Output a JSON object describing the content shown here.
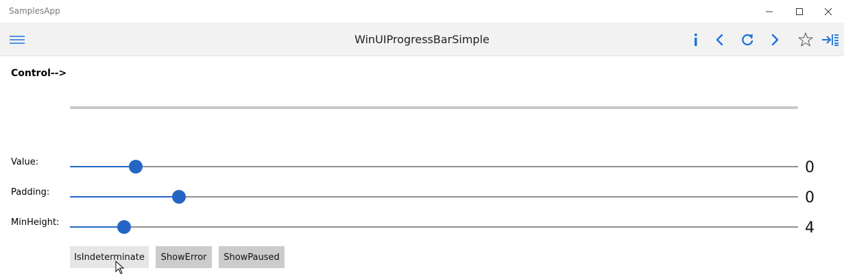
{
  "window": {
    "app_title": "SamplesApp",
    "controls": [
      "minimize-icon",
      "maximize-icon",
      "close-icon"
    ]
  },
  "command_bar": {
    "page_title": "WinUIProgressBarSimple",
    "accent_color": "#1a73d9",
    "icons": [
      "hamburger-icon",
      "info-icon",
      "back-icon",
      "refresh-icon",
      "forward-icon",
      "star-icon",
      "pin-panel-icon"
    ]
  },
  "content": {
    "control_label": "Control-->",
    "progress_bar": {
      "value_fraction": 0
    },
    "sliders": [
      {
        "label": "Value:",
        "value": "0",
        "position_fraction": 0.09
      },
      {
        "label": "Padding:",
        "value": "0",
        "position_fraction": 0.15
      },
      {
        "label": "MinHeight:",
        "value": "4",
        "position_fraction": 0.074
      }
    ],
    "buttons": [
      {
        "label": "IsIndeterminate"
      },
      {
        "label": "ShowError"
      },
      {
        "label": "ShowPaused"
      }
    ]
  }
}
